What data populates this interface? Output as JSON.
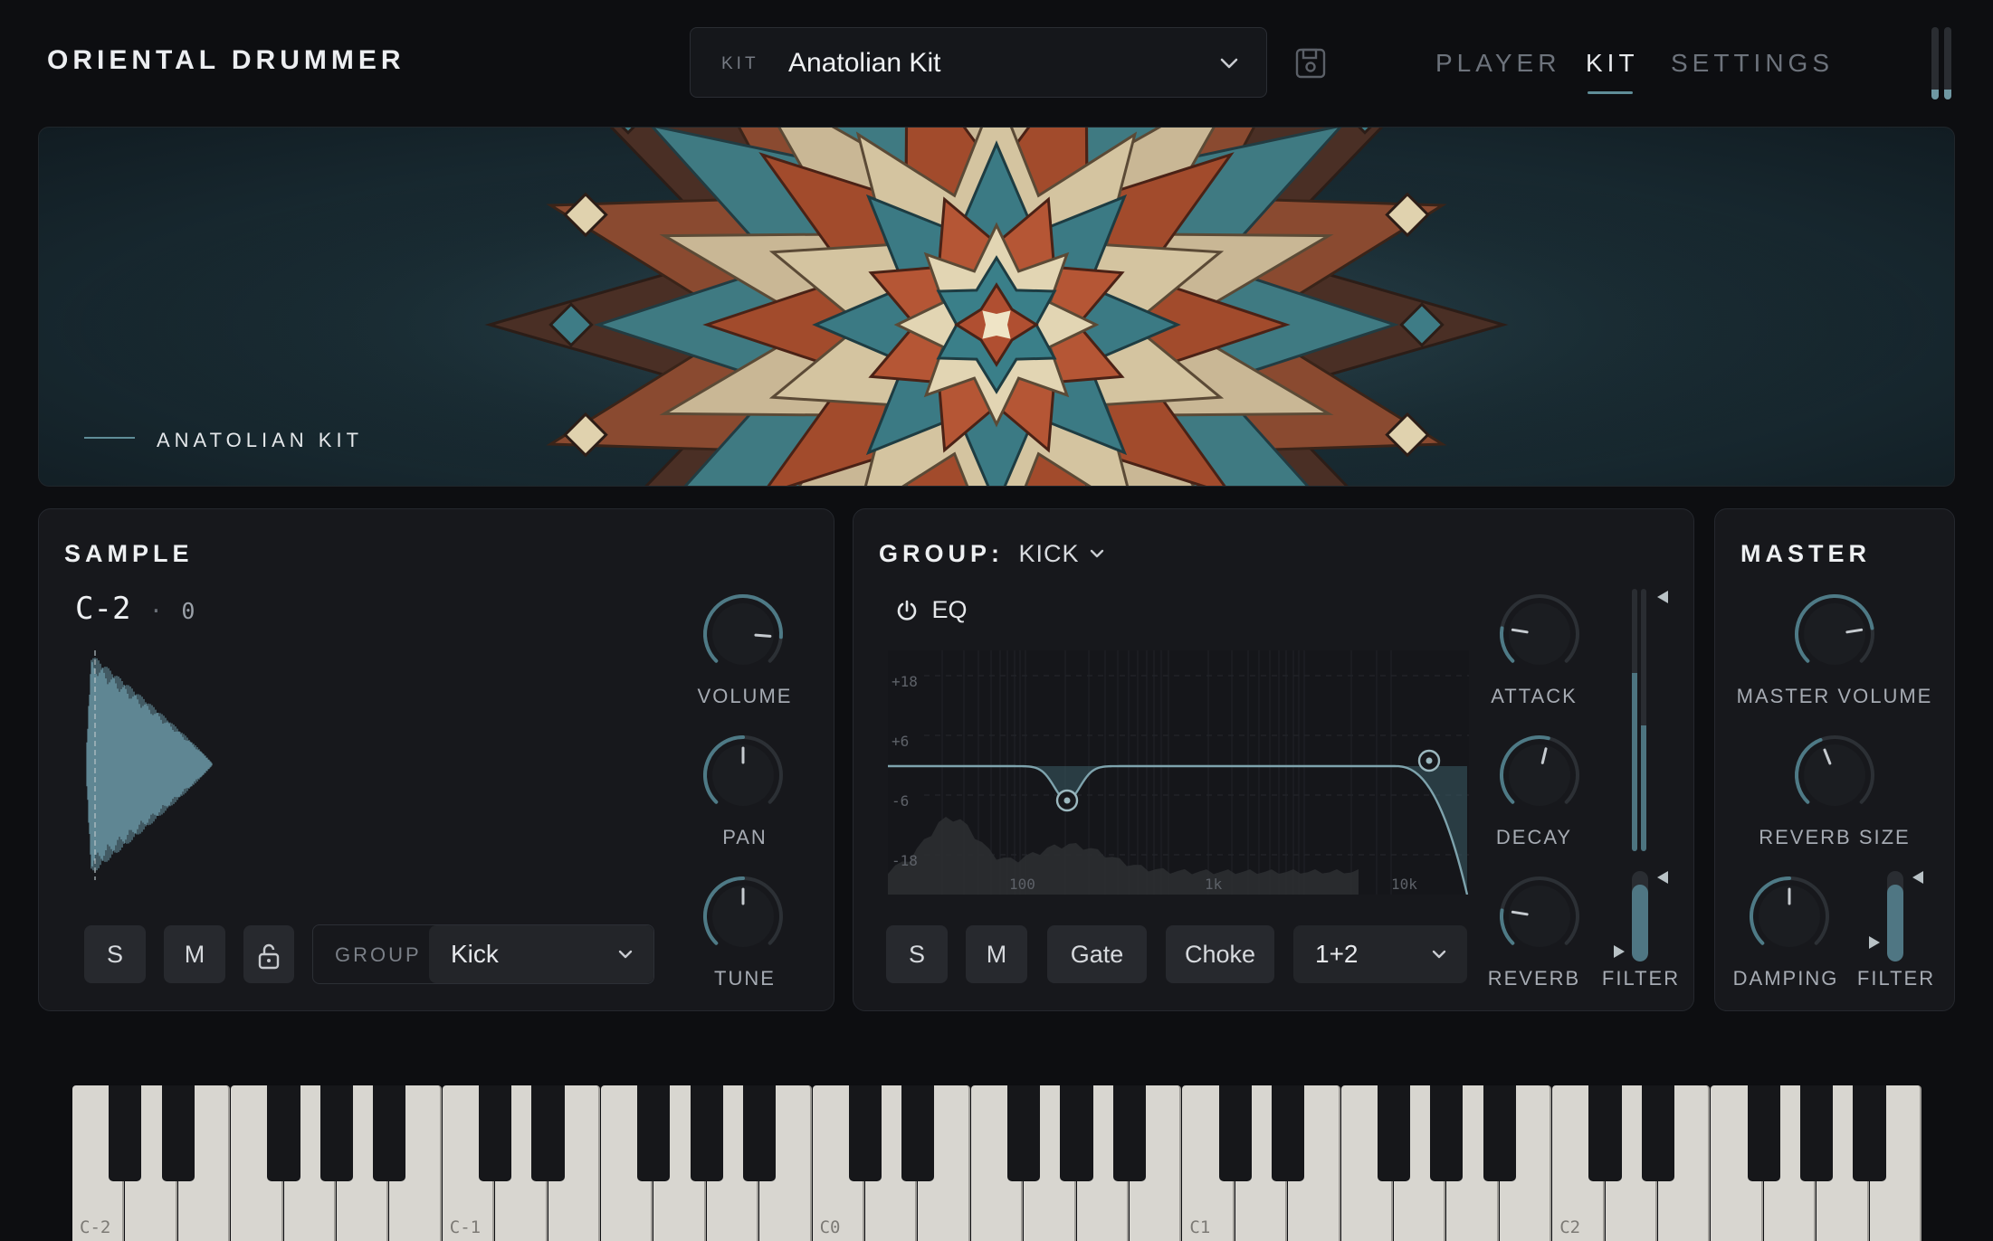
{
  "app": {
    "title": "ORIENTAL DRUMMER"
  },
  "header": {
    "kit_label": "KIT",
    "kit_value": "Anatolian Kit",
    "tabs": [
      {
        "label": "PLAYER",
        "active": false
      },
      {
        "label": "KIT",
        "active": true
      },
      {
        "label": "SETTINGS",
        "active": false
      }
    ]
  },
  "banner": {
    "label": "ANATOLIAN KIT"
  },
  "sample": {
    "title": "SAMPLE",
    "note": "C-2",
    "separator": "·",
    "velocity": "0",
    "knobs": [
      {
        "label": "VOLUME",
        "value": 0.85
      },
      {
        "label": "PAN",
        "value": 0.5
      },
      {
        "label": "TUNE",
        "value": 0.5
      }
    ],
    "buttons": {
      "solo": "S",
      "mute": "M"
    },
    "group_label": "GROUP",
    "group_value": "Kick"
  },
  "group": {
    "title": "GROUP:",
    "name": "KICK",
    "eq_label": "EQ",
    "eq_y_labels": [
      "+18",
      "+6",
      "-6",
      "-18"
    ],
    "eq_x_labels": [
      "100",
      "1k",
      "10k"
    ],
    "knobs": [
      {
        "label": "ATTACK",
        "value": 0.2
      },
      {
        "label": "DECAY",
        "value": 0.55
      },
      {
        "label": "REVERB",
        "value": 0.2
      }
    ],
    "filter_label": "FILTER",
    "filter_value": 0.85,
    "buttons": {
      "solo": "S",
      "mute": "M",
      "gate": "Gate",
      "choke": "Choke"
    },
    "output_value": "1+2"
  },
  "master": {
    "title": "MASTER",
    "knobs": [
      {
        "label": "MASTER VOLUME",
        "value": 0.8
      },
      {
        "label": "REVERB SIZE",
        "value": 0.42
      },
      {
        "label": "DAMPING",
        "value": 0.5
      }
    ],
    "filter_label": "FILTER",
    "filter_value": 0.85
  },
  "keyboard": {
    "octave_labels": [
      "C-2",
      "C-1",
      "C0",
      "C1",
      "C2"
    ]
  },
  "colors": {
    "accent": "#5f8d98",
    "panel": "#17181c",
    "background": "#0d0e11"
  }
}
